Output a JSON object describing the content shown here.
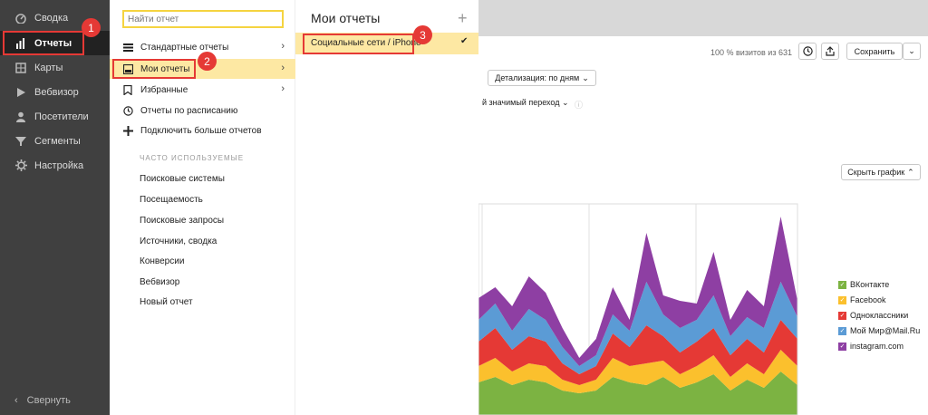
{
  "sidebar": {
    "items": [
      {
        "label": "Сводка",
        "icon": "dashboard-icon"
      },
      {
        "label": "Отчеты",
        "icon": "bar-chart-icon"
      },
      {
        "label": "Карты",
        "icon": "map-icon"
      },
      {
        "label": "Вебвизор",
        "icon": "play-icon"
      },
      {
        "label": "Посетители",
        "icon": "user-icon"
      },
      {
        "label": "Сегменты",
        "icon": "filter-icon"
      },
      {
        "label": "Настройка",
        "icon": "gear-icon"
      }
    ],
    "collapse_label": "Свернуть"
  },
  "badges": [
    "1",
    "2",
    "3"
  ],
  "menu": {
    "search_placeholder": "Найти отчет",
    "items": [
      {
        "label": "Стандартные отчеты",
        "icon": "list-icon"
      },
      {
        "label": "Мои отчеты",
        "icon": "folder-icon"
      },
      {
        "label": "Избранные",
        "icon": "bookmark-icon"
      },
      {
        "label": "Отчеты по расписанию",
        "icon": "clock-icon"
      },
      {
        "label": "Подключить больше отчетов",
        "icon": "plus-icon"
      }
    ],
    "section_label": "ЧАСТО ИСПОЛЬЗУЕМЫЕ",
    "frequent": [
      "Поисковые системы",
      "Посещаемость",
      "Поисковые запросы",
      "Источники, сводка",
      "Конверсии",
      "Вебвизор",
      "Новый отчет"
    ]
  },
  "my_reports": {
    "title": "Мои отчеты",
    "items": [
      "Социальные сети / iPhone"
    ]
  },
  "background": {
    "visits": "100 % визитов из 631",
    "save_label": "Сохранить",
    "detail_label": "Детализация: по дням",
    "transition_label": "й значимый переход",
    "hide_chart_label": "Скрыть график"
  },
  "colors": {
    "accent": "#e53935",
    "highlight": "#fde8a3",
    "sidebar": "#404040"
  },
  "chart_data": {
    "type": "area",
    "series": [
      {
        "name": "ВКонтакте",
        "color": "#7cb342",
        "values": [
          12,
          14,
          11,
          13,
          12,
          9,
          8,
          9,
          14,
          12,
          11,
          14,
          10,
          12,
          15,
          9,
          13,
          10,
          16,
          11
        ]
      },
      {
        "name": "Facebook",
        "color": "#fbc02d",
        "values": [
          6,
          7,
          5,
          6,
          6,
          4,
          3,
          4,
          7,
          6,
          8,
          6,
          5,
          6,
          7,
          5,
          6,
          5,
          8,
          7
        ]
      },
      {
        "name": "Одноклассники",
        "color": "#e53935",
        "values": [
          9,
          11,
          8,
          10,
          9,
          6,
          4,
          5,
          9,
          7,
          14,
          9,
          8,
          9,
          10,
          8,
          9,
          8,
          11,
          10
        ]
      },
      {
        "name": "Мой Мир@Mail.Ru",
        "color": "#5b9bd5",
        "values": [
          8,
          9,
          7,
          10,
          8,
          6,
          3,
          4,
          7,
          6,
          16,
          8,
          9,
          8,
          12,
          7,
          8,
          9,
          14,
          8
        ]
      },
      {
        "name": "instagram.com",
        "color": "#8e3fa3",
        "values": [
          8,
          6,
          9,
          12,
          10,
          7,
          3,
          6,
          10,
          4,
          18,
          7,
          10,
          6,
          16,
          6,
          10,
          8,
          24,
          6
        ]
      }
    ]
  }
}
